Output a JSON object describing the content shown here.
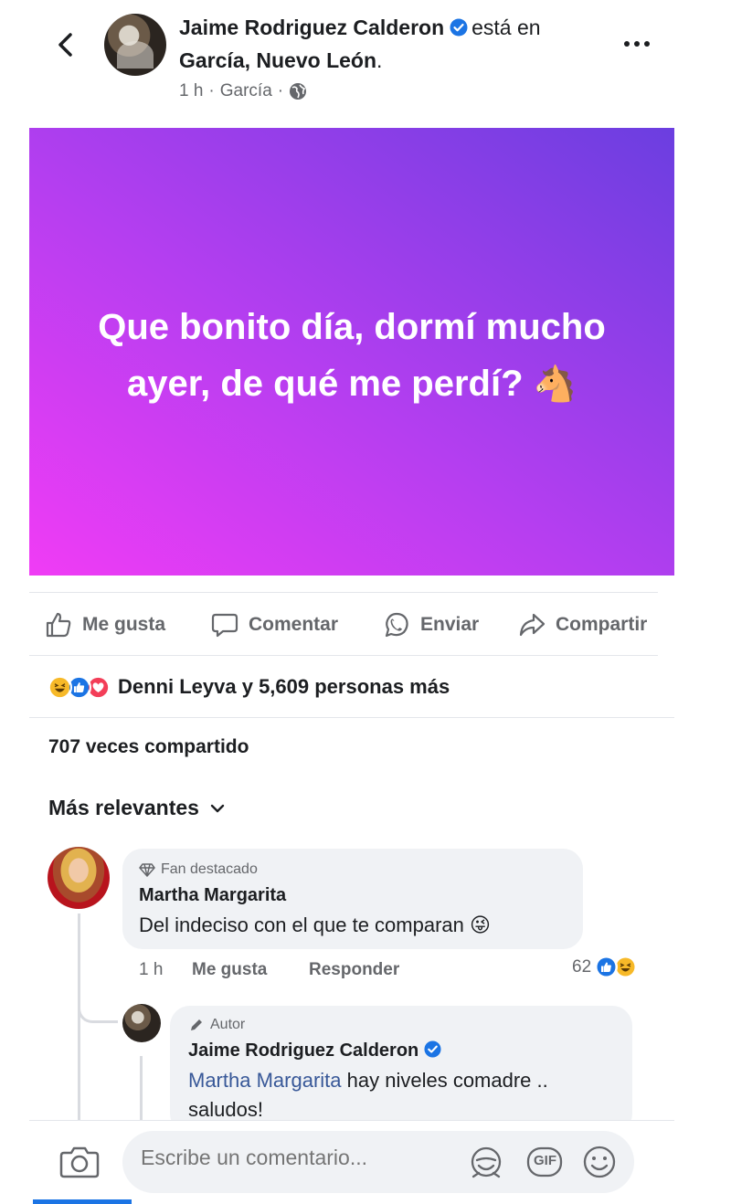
{
  "header": {
    "author": "Jaime Rodriguez Calderon",
    "is_at": "está en",
    "location": "García, Nuevo León",
    "location_dot": ".",
    "time": "1 h",
    "place": "García",
    "separator": "·"
  },
  "post": {
    "text": "Que bonito día, dormí mucho ayer, de qué me perdí?",
    "emoji": "🐴",
    "gradient": [
      "#f03cf5",
      "#6b3ee0"
    ]
  },
  "actions": {
    "like": "Me gusta",
    "comment": "Comentar",
    "send": "Enviar",
    "share": "Compartir"
  },
  "reactions": {
    "summary": "Denni Leyva y 5,609 personas más",
    "icons": [
      "haha",
      "like",
      "love"
    ]
  },
  "shares": "707 veces compartido",
  "sort": {
    "label": "Más relevantes"
  },
  "comments": [
    {
      "badge": "Fan destacado",
      "name": "Martha Margarita",
      "text": "Del indeciso con el que te comparan",
      "emoji": "😜",
      "time": "1 h",
      "like": "Me gusta",
      "reply": "Responder",
      "count": "62"
    },
    {
      "badge": "Autor",
      "name": "Jaime Rodriguez Calderon",
      "mention": "Martha Margarita",
      "text": "hay niveles comadre ..",
      "text2": "saludos!"
    }
  ],
  "composer": {
    "placeholder": "Escribe un comentario...",
    "gif": "GIF"
  },
  "colors": {
    "accent": "#1b74e4",
    "secondary_text": "#65676b",
    "bubble": "#f0f2f5"
  }
}
